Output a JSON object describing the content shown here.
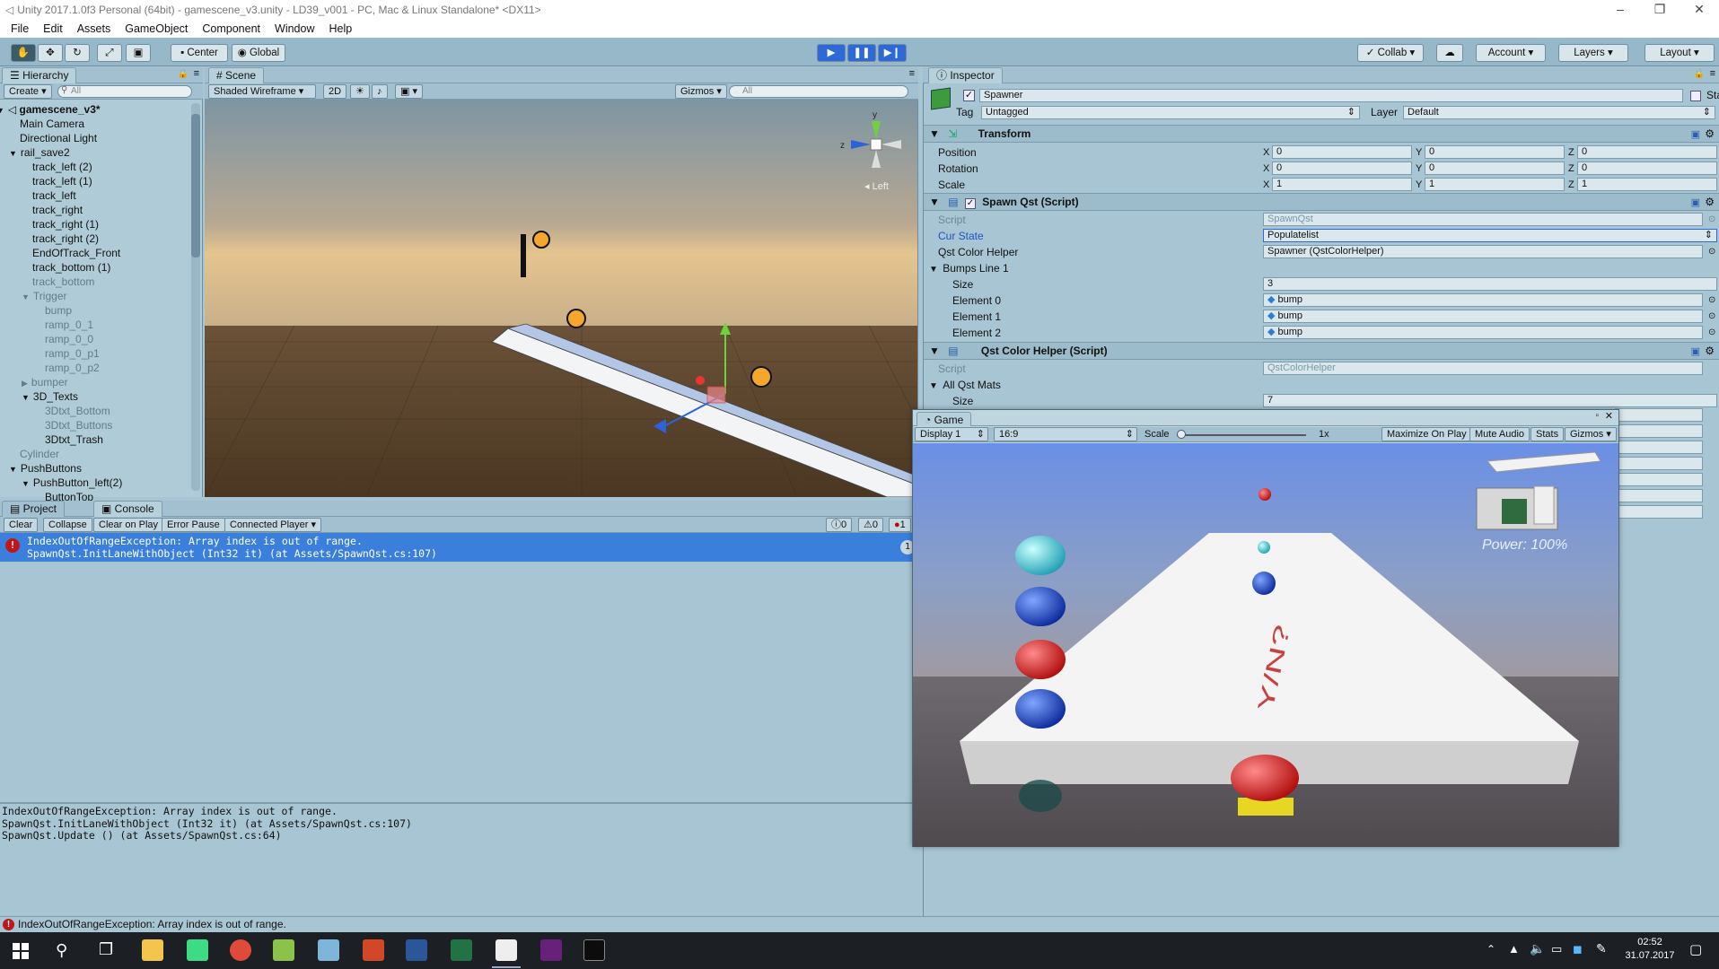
{
  "window": {
    "title": "Unity 2017.1.0f3 Personal (64bit) - gamescene_v3.unity - LD39_v001 - PC, Mac & Linux Standalone* <DX11>"
  },
  "menu": [
    "File",
    "Edit",
    "Assets",
    "GameObject",
    "Component",
    "Window",
    "Help"
  ],
  "toolbar": {
    "pivot_label": "Center",
    "space_label": "Global",
    "collab_label": "Collab",
    "account_label": "Account",
    "layers_label": "Layers",
    "layout_label": "Layout"
  },
  "hierarchy": {
    "tab": "Hierarchy",
    "create_label": "Create",
    "search_placeholder": "All",
    "items": [
      {
        "label": "gamescene_v3*",
        "indent": 0,
        "bold": true,
        "arrow": "down"
      },
      {
        "label": "Main Camera",
        "indent": 1
      },
      {
        "label": "Directional Light",
        "indent": 1
      },
      {
        "label": "rail_save2",
        "indent": 1,
        "arrow": "down"
      },
      {
        "label": "track_left (2)",
        "indent": 2
      },
      {
        "label": "track_left (1)",
        "indent": 2
      },
      {
        "label": "track_left",
        "indent": 2
      },
      {
        "label": "track_right",
        "indent": 2
      },
      {
        "label": "track_right (1)",
        "indent": 2
      },
      {
        "label": "track_right (2)",
        "indent": 2
      },
      {
        "label": "EndOfTrack_Front",
        "indent": 2
      },
      {
        "label": "track_bottom (1)",
        "indent": 2
      },
      {
        "label": "track_bottom",
        "indent": 2,
        "dim": true
      },
      {
        "label": "Trigger",
        "indent": 2,
        "arrow": "down",
        "dim": true
      },
      {
        "label": "bump",
        "indent": 3,
        "dim": true
      },
      {
        "label": "ramp_0_1",
        "indent": 3,
        "dim": true
      },
      {
        "label": "ramp_0_0",
        "indent": 3,
        "dim": true
      },
      {
        "label": "ramp_0_p1",
        "indent": 3,
        "dim": true
      },
      {
        "label": "ramp_0_p2",
        "indent": 3,
        "dim": true
      },
      {
        "label": "bumper",
        "indent": 2,
        "arrow": "right",
        "dim": true
      },
      {
        "label": "3D_Texts",
        "indent": 2,
        "arrow": "down"
      },
      {
        "label": "3Dtxt_Bottom",
        "indent": 3,
        "dim": true
      },
      {
        "label": "3Dtxt_Buttons",
        "indent": 3,
        "dim": true
      },
      {
        "label": "3Dtxt_Trash",
        "indent": 3
      },
      {
        "label": "Cylinder",
        "indent": 1,
        "dim": true
      },
      {
        "label": "PushButtons",
        "indent": 1,
        "arrow": "down"
      },
      {
        "label": "PushButton_left(2)",
        "indent": 2,
        "arrow": "down"
      },
      {
        "label": "ButtonTop",
        "indent": 3
      }
    ]
  },
  "scene": {
    "tab": "Scene",
    "shading": "Shaded Wireframe",
    "mode_2d": "2D",
    "gizmos": "Gizmos",
    "search_placeholder": "All",
    "gizmo_view": "Left",
    "axis_y": "y",
    "axis_z": "z"
  },
  "inspector": {
    "tab": "Inspector",
    "object_name": "Spawner",
    "static_label": "Static",
    "tag_label": "Tag",
    "tag_value": "Untagged",
    "layer_label": "Layer",
    "layer_value": "Default",
    "transform": {
      "title": "Transform",
      "rows": [
        {
          "label": "Position",
          "x": "0",
          "y": "0",
          "z": "0"
        },
        {
          "label": "Rotation",
          "x": "0",
          "y": "0",
          "z": "0"
        },
        {
          "label": "Scale",
          "x": "1",
          "y": "1",
          "z": "1"
        }
      ],
      "axis_x": "X",
      "axis_y": "Y",
      "axis_z": "Z"
    },
    "spawn": {
      "title": "Spawn Qst (Script)",
      "script_label": "Script",
      "script_value": "SpawnQst",
      "cur_state_label": "Cur State",
      "cur_state_value": "Populatelist",
      "helper_label": "Qst Color Helper",
      "helper_value": "Spawner (QstColorHelper)",
      "bumps_label": "Bumps Line 1",
      "size_label": "Size",
      "size_value": "3",
      "elements": [
        {
          "label": "Element 0",
          "value": "bump"
        },
        {
          "label": "Element 1",
          "value": "bump"
        },
        {
          "label": "Element 2",
          "value": "bump"
        }
      ]
    },
    "helper": {
      "title": "Qst Color Helper (Script)",
      "script_label": "Script",
      "script_value": "QstColorHelper",
      "mats_label": "All Qst Mats",
      "size_label": "Size",
      "size_value": "7"
    }
  },
  "console": {
    "project_tab": "Project",
    "console_tab": "Console",
    "clear": "Clear",
    "collapse": "Collapse",
    "clear_on_play": "Clear on Play",
    "error_pause": "Error Pause",
    "connected_player": "Connected Player",
    "log_count": "0",
    "warn_count": "0",
    "error_count": "1",
    "entry_line1": "IndexOutOfRangeException: Array index is out of range.",
    "entry_line2": "SpawnQst.InitLaneWithObject (Int32 it) (at Assets/SpawnQst.cs:107)",
    "entry_count": "1",
    "detail_line1": "IndexOutOfRangeException: Array index is out of range.",
    "detail_line2": "SpawnQst.InitLaneWithObject (Int32 it) (at Assets/SpawnQst.cs:107)",
    "detail_line3": "SpawnQst.Update () (at Assets/SpawnQst.cs:64)"
  },
  "game": {
    "tab": "Game",
    "display": "Display 1",
    "aspect": "16:9",
    "scale_label": "Scale",
    "scale_value": "1x",
    "maximize": "Maximize On Play",
    "mute": "Mute Audio",
    "stats": "Stats",
    "gizmos": "Gizmos",
    "power_text": "Power: 100%",
    "track_text": "Y/N?"
  },
  "status": {
    "message": "IndexOutOfRangeException: Array index is out of range."
  },
  "taskbar": {
    "time": "02:52",
    "date": "31.07.2017"
  }
}
